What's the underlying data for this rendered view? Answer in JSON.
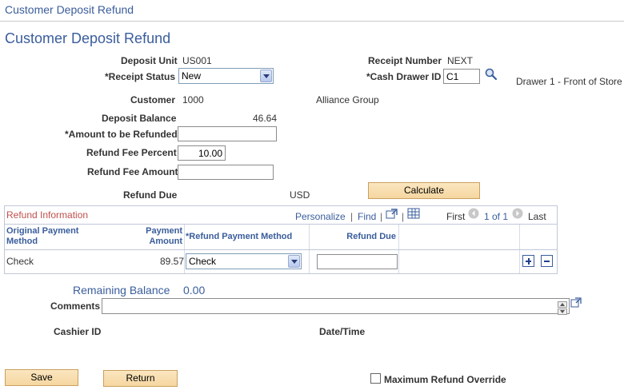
{
  "window_title": "Customer Deposit Refund",
  "page_title": "Customer Deposit Refund",
  "form": {
    "deposit_unit_label": "Deposit Unit",
    "deposit_unit_value": "US001",
    "receipt_number_label": "Receipt Number",
    "receipt_number_value": "NEXT",
    "receipt_status_label": "*Receipt Status",
    "receipt_status_value": "New",
    "cash_drawer_label": "*Cash Drawer ID",
    "cash_drawer_value": "C1",
    "drawer_description": "Drawer 1 - Front of Store",
    "customer_label": "Customer",
    "customer_value": "1000",
    "customer_name": "Alliance Group",
    "deposit_balance_label": "Deposit Balance",
    "deposit_balance_value": "46.64",
    "amount_refunded_label": "*Amount to be Refunded",
    "amount_refunded_value": "",
    "refund_fee_percent_label": "Refund Fee Percent",
    "refund_fee_percent_value": "10.00",
    "refund_fee_amount_label": "Refund Fee Amount",
    "refund_fee_amount_value": "",
    "refund_due_label": "Refund Due",
    "refund_due_currency": "USD",
    "calculate_label": "Calculate"
  },
  "grid": {
    "title": "Refund Information",
    "personalize": "Personalize",
    "find": "Find",
    "first": "First",
    "pagination": "1 of 1",
    "last": "Last",
    "columns": {
      "orig_method_line1": "Original Payment",
      "orig_method_line2": "Method",
      "payment_amount_line1": "Payment",
      "payment_amount_line2": "Amount",
      "refund_method": "*Refund Payment Method",
      "refund_due": "Refund Due"
    },
    "rows": [
      {
        "orig_method": "Check",
        "payment_amount": "89.57",
        "refund_method": "Check",
        "refund_due": ""
      }
    ]
  },
  "footer": {
    "remaining_balance_label": "Remaining Balance",
    "remaining_balance_value": "0.00",
    "comments_label": "Comments",
    "comments_value": "",
    "cashier_label": "Cashier ID",
    "datetime_label": "Date/Time",
    "save_label": "Save",
    "return_label": "Return",
    "max_refund_override_label": "Maximum Refund Override",
    "max_refund_override_checked": false
  }
}
